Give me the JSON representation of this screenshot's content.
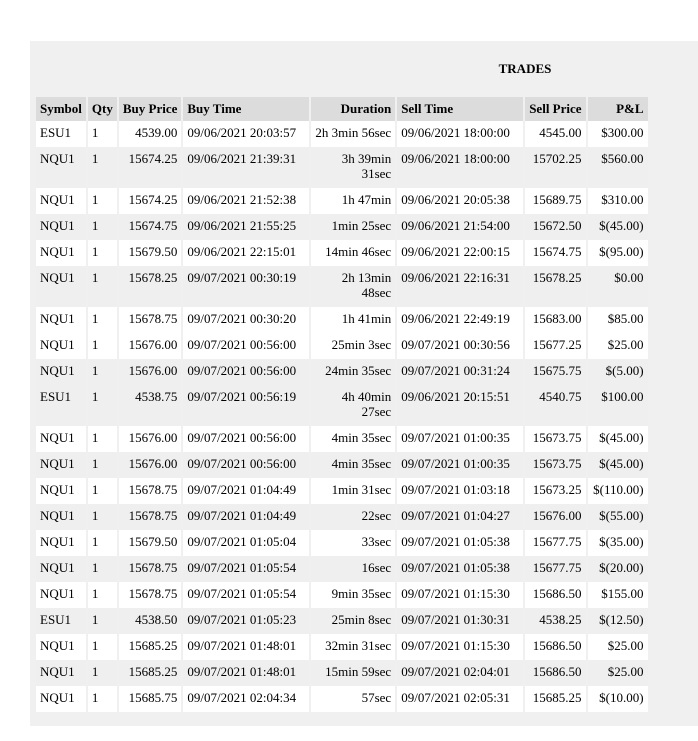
{
  "title": "TRADES",
  "columns": [
    "Symbol",
    "Qty",
    "Buy Price",
    "Buy Time",
    "Duration",
    "Sell Time",
    "Sell Price",
    "P&L"
  ],
  "rows": [
    {
      "symbol": "ESU1",
      "qty": "1",
      "buy_price": "4539.00",
      "buy_time": "09/06/2021 20:03:57",
      "duration": [
        "2h 3min 56sec"
      ],
      "sell_time": "09/06/2021 18:00:00",
      "sell_price": "4545.00",
      "pnl": "$300.00"
    },
    {
      "symbol": "NQU1",
      "qty": "1",
      "buy_price": "15674.25",
      "buy_time": "09/06/2021 21:39:31",
      "duration": [
        "3h 39min",
        "31sec"
      ],
      "sell_time": "09/06/2021 18:00:00",
      "sell_price": "15702.25",
      "pnl": "$560.00"
    },
    {
      "symbol": "NQU1",
      "qty": "1",
      "buy_price": "15674.25",
      "buy_time": "09/06/2021 21:52:38",
      "duration": [
        "1h 47min"
      ],
      "sell_time": "09/06/2021 20:05:38",
      "sell_price": "15689.75",
      "pnl": "$310.00"
    },
    {
      "symbol": "NQU1",
      "qty": "1",
      "buy_price": "15674.75",
      "buy_time": "09/06/2021 21:55:25",
      "duration": [
        "1min 25sec"
      ],
      "sell_time": "09/06/2021 21:54:00",
      "sell_price": "15672.50",
      "pnl": "$(45.00)"
    },
    {
      "symbol": "NQU1",
      "qty": "1",
      "buy_price": "15679.50",
      "buy_time": "09/06/2021 22:15:01",
      "duration": [
        "14min 46sec"
      ],
      "sell_time": "09/06/2021 22:00:15",
      "sell_price": "15674.75",
      "pnl": "$(95.00)"
    },
    {
      "symbol": "NQU1",
      "qty": "1",
      "buy_price": "15678.25",
      "buy_time": "09/07/2021 00:30:19",
      "duration": [
        "2h 13min",
        "48sec"
      ],
      "sell_time": "09/06/2021 22:16:31",
      "sell_price": "15678.25",
      "pnl": "$0.00"
    },
    {
      "symbol": "NQU1",
      "qty": "1",
      "buy_price": "15678.75",
      "buy_time": "09/07/2021 00:30:20",
      "duration": [
        "1h 41min"
      ],
      "sell_time": "09/06/2021 22:49:19",
      "sell_price": "15683.00",
      "pnl": "$85.00"
    },
    {
      "symbol": "NQU1",
      "qty": "1",
      "buy_price": "15676.00",
      "buy_time": "09/07/2021 00:56:00",
      "duration": [
        "25min 3sec"
      ],
      "sell_time": "09/07/2021 00:30:56",
      "sell_price": "15677.25",
      "pnl": "$25.00"
    },
    {
      "symbol": "NQU1",
      "qty": "1",
      "buy_price": "15676.00",
      "buy_time": "09/07/2021 00:56:00",
      "duration": [
        "24min 35sec"
      ],
      "sell_time": "09/07/2021 00:31:24",
      "sell_price": "15675.75",
      "pnl": "$(5.00)"
    },
    {
      "symbol": "ESU1",
      "qty": "1",
      "buy_price": "4538.75",
      "buy_time": "09/07/2021 00:56:19",
      "duration": [
        "4h 40min",
        "27sec"
      ],
      "sell_time": "09/06/2021 20:15:51",
      "sell_price": "4540.75",
      "pnl": "$100.00"
    },
    {
      "symbol": "NQU1",
      "qty": "1",
      "buy_price": "15676.00",
      "buy_time": "09/07/2021 00:56:00",
      "duration": [
        "4min 35sec"
      ],
      "sell_time": "09/07/2021 01:00:35",
      "sell_price": "15673.75",
      "pnl": "$(45.00)"
    },
    {
      "symbol": "NQU1",
      "qty": "1",
      "buy_price": "15676.00",
      "buy_time": "09/07/2021 00:56:00",
      "duration": [
        "4min 35sec"
      ],
      "sell_time": "09/07/2021 01:00:35",
      "sell_price": "15673.75",
      "pnl": "$(45.00)"
    },
    {
      "symbol": "NQU1",
      "qty": "1",
      "buy_price": "15678.75",
      "buy_time": "09/07/2021 01:04:49",
      "duration": [
        "1min 31sec"
      ],
      "sell_time": "09/07/2021 01:03:18",
      "sell_price": "15673.25",
      "pnl": "$(110.00)"
    },
    {
      "symbol": "NQU1",
      "qty": "1",
      "buy_price": "15678.75",
      "buy_time": "09/07/2021 01:04:49",
      "duration": [
        "22sec"
      ],
      "sell_time": "09/07/2021 01:04:27",
      "sell_price": "15676.00",
      "pnl": "$(55.00)"
    },
    {
      "symbol": "NQU1",
      "qty": "1",
      "buy_price": "15679.50",
      "buy_time": "09/07/2021 01:05:04",
      "duration": [
        "33sec"
      ],
      "sell_time": "09/07/2021 01:05:38",
      "sell_price": "15677.75",
      "pnl": "$(35.00)"
    },
    {
      "symbol": "NQU1",
      "qty": "1",
      "buy_price": "15678.75",
      "buy_time": "09/07/2021 01:05:54",
      "duration": [
        "16sec"
      ],
      "sell_time": "09/07/2021 01:05:38",
      "sell_price": "15677.75",
      "pnl": "$(20.00)"
    },
    {
      "symbol": "NQU1",
      "qty": "1",
      "buy_price": "15678.75",
      "buy_time": "09/07/2021 01:05:54",
      "duration": [
        "9min 35sec"
      ],
      "sell_time": "09/07/2021 01:15:30",
      "sell_price": "15686.50",
      "pnl": "$155.00"
    },
    {
      "symbol": "ESU1",
      "qty": "1",
      "buy_price": "4538.50",
      "buy_time": "09/07/2021 01:05:23",
      "duration": [
        "25min 8sec"
      ],
      "sell_time": "09/07/2021 01:30:31",
      "sell_price": "4538.25",
      "pnl": "$(12.50)"
    },
    {
      "symbol": "NQU1",
      "qty": "1",
      "buy_price": "15685.25",
      "buy_time": "09/07/2021 01:48:01",
      "duration": [
        "32min 31sec"
      ],
      "sell_time": "09/07/2021 01:15:30",
      "sell_price": "15686.50",
      "pnl": "$25.00"
    },
    {
      "symbol": "NQU1",
      "qty": "1",
      "buy_price": "15685.25",
      "buy_time": "09/07/2021 01:48:01",
      "duration": [
        "15min 59sec"
      ],
      "sell_time": "09/07/2021 02:04:01",
      "sell_price": "15686.50",
      "pnl": "$25.00"
    },
    {
      "symbol": "NQU1",
      "qty": "1",
      "buy_price": "15685.75",
      "buy_time": "09/07/2021 02:04:34",
      "duration": [
        "57sec"
      ],
      "sell_time": "09/07/2021 02:05:31",
      "sell_price": "15685.25",
      "pnl": "$(10.00)"
    }
  ]
}
